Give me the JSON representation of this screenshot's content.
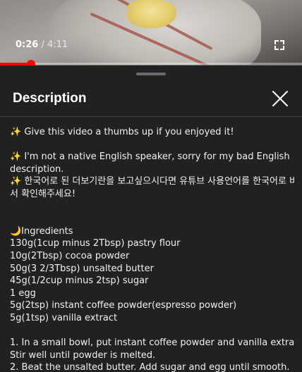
{
  "player": {
    "current_time": "0:26",
    "separator": " / ",
    "duration": "4:11",
    "progress_fraction": 0.1036
  },
  "description_panel": {
    "title": "Description",
    "intro": {
      "line1": "✨ Give this video a thumbs up if you enjoyed it!",
      "line2": "✨ I'm not a native English speaker, sorry for my bad English",
      "line3": "description.",
      "line4": "✨ 한국어로 된 더보기란을 보고싶으시다면 유튜브 사용언어를 한국어로 바꿔",
      "line5": "서 확인해주세요!"
    },
    "ingredients": {
      "heading": "🌙Ingredients",
      "items": [
        "130g(1cup minus 2Tbsp) pastry flour",
        "10g(2Tbsp) cocoa powder",
        "50g(3 2/3Tbsp) unsalted butter",
        "45g(1/2cup minus 2tsp) sugar",
        "1 egg",
        "5g(2tsp) instant coffee powder(espresso powder)",
        "5g(1tsp) vanilla extract"
      ]
    },
    "steps": {
      "line1": "1. In a small bowl, put instant coffee powder and vanilla extract.",
      "line2": "Stir well until powder is melted.",
      "line3": "2. Beat the unsalted butter. Add sugar and egg until smooth."
    }
  }
}
